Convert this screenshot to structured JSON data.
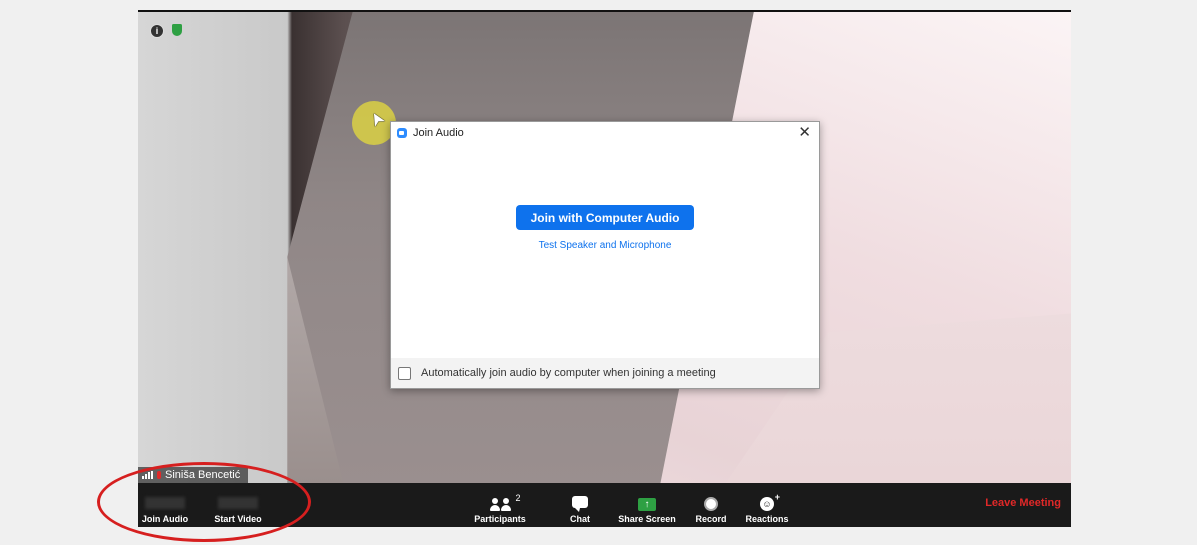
{
  "video": {
    "participant_name": "Siniša Bencetić"
  },
  "dialog": {
    "title": "Join Audio",
    "close_glyph": "✕",
    "join_button": "Join with Computer Audio",
    "test_link": "Test Speaker and Microphone",
    "auto_join_label": "Automatically join audio by computer when joining a meeting",
    "auto_join_checked": false
  },
  "toolbar": {
    "join_audio": "Join Audio",
    "start_video": "Start Video",
    "participants": "Participants",
    "participant_count": "2",
    "chat": "Chat",
    "share_screen": "Share Screen",
    "record": "Record",
    "reactions": "Reactions",
    "leave": "Leave Meeting"
  },
  "icons": {
    "info": "i",
    "share_arrow": "↑",
    "cursor": "➤",
    "reaction": "☺"
  },
  "colors": {
    "accent": "#0e72ed",
    "leave": "#e02828",
    "share": "#2ea043",
    "annotation": "#d61f1f"
  }
}
